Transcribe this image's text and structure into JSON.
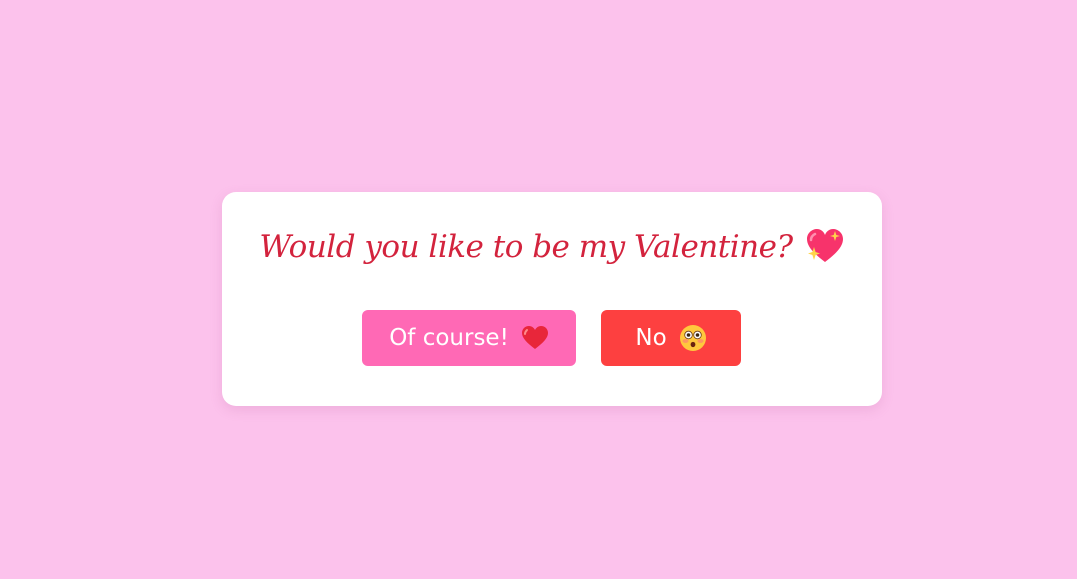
{
  "page": {
    "background_color": "#fcc2ec"
  },
  "card": {
    "question": "Would you like to be my Valentine?",
    "question_icon": "sparkling-heart-icon",
    "question_color": "#d3233d"
  },
  "buttons": {
    "yes": {
      "label": "Of course!",
      "icon": "red-heart-icon",
      "color": "#ff69b5"
    },
    "no": {
      "label": "No",
      "icon": "flushed-face-icon",
      "color": "#fd4040"
    }
  }
}
